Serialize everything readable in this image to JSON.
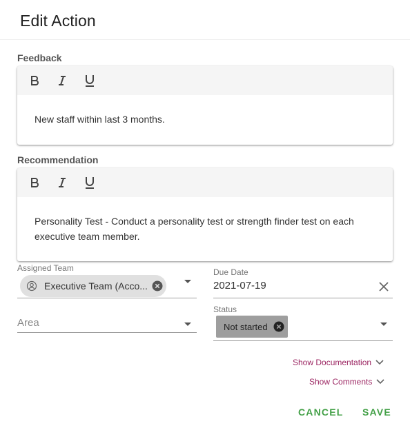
{
  "dialog": {
    "title": "Edit Action"
  },
  "feedback": {
    "label": "Feedback",
    "text": "New staff within last 3 months."
  },
  "recommendation": {
    "label": "Recommendation",
    "text": "Personality Test - Conduct a personality test or strength finder test on each executive team member."
  },
  "toolbar": {
    "bold": "B",
    "italic": "I",
    "underline": "U"
  },
  "assigned_team": {
    "label": "Assigned Team",
    "value": "Executive Team (Acco..."
  },
  "due_date": {
    "label": "Due Date",
    "value": "2021-07-19"
  },
  "area": {
    "placeholder": "Area"
  },
  "status": {
    "label": "Status",
    "value": "Not started"
  },
  "links": {
    "show_documentation": "Show Documentation",
    "show_comments": "Show Comments"
  },
  "actions": {
    "cancel": "CANCEL",
    "save": "SAVE"
  },
  "colors": {
    "accent_link": "#9c2763",
    "action_green": "#43a047",
    "chip_grey": "#e0e0e0",
    "status_chip": "#9e9e9e"
  }
}
